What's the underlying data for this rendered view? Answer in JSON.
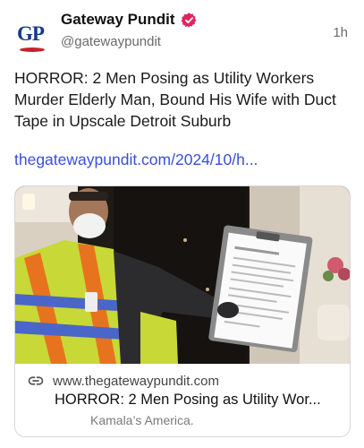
{
  "author": {
    "logo_text": "GP",
    "name": "Gateway Pundit",
    "handle": "@gatewaypundit",
    "time": "1h"
  },
  "post": {
    "text": "HORROR: 2 Men Posing as Utility Workers Murder Elderly Man, Bound His Wife with Duct Tape in Upscale Detroit Suburb",
    "link_text": "thegatewaypundit.com/2024/10/h..."
  },
  "card": {
    "domain": "www.thegatewaypundit.com",
    "title": "HORROR: 2 Men Posing as Utility Wor...",
    "subtitle": "Kamala’s America.",
    "image_alt": "Man in face mask and hi-vis vest holding a clipboard at a front door"
  },
  "icons": {
    "verified": "verified-badge-icon",
    "link": "link-icon"
  },
  "colors": {
    "brand_blue": "#123a8c",
    "brand_red": "#c8202b",
    "verified_pink": "#e0245e",
    "link": "#3b4fd6"
  }
}
